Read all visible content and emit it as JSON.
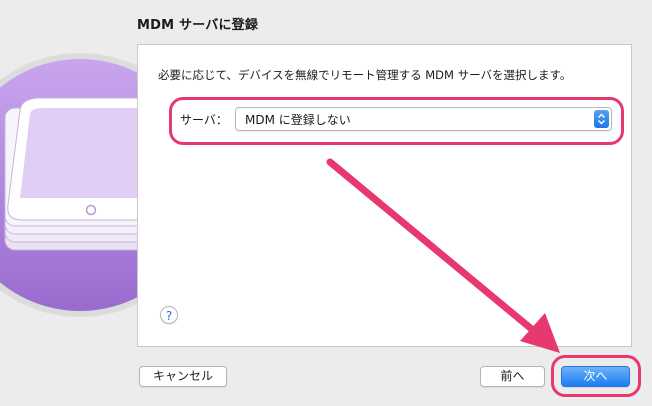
{
  "dialog": {
    "title": "MDM サーバに登録",
    "instruction": "必要に応じて、デバイスを無線でリモート管理する MDM サーバを選択します。",
    "server_label": "サーバ：",
    "server_selected": "MDM に登録しない",
    "help_label": "?"
  },
  "buttons": {
    "cancel": "キャンセル",
    "back": "前へ",
    "next": "次へ"
  },
  "colors": {
    "highlight": "#e7396f",
    "accent": "#1c7cf0",
    "illustration": "#b98de4"
  },
  "icons": {
    "illustration": "stacked-ipads-icon",
    "select": "chevron-updown-icon",
    "arrow": "pointer-arrow-icon"
  }
}
